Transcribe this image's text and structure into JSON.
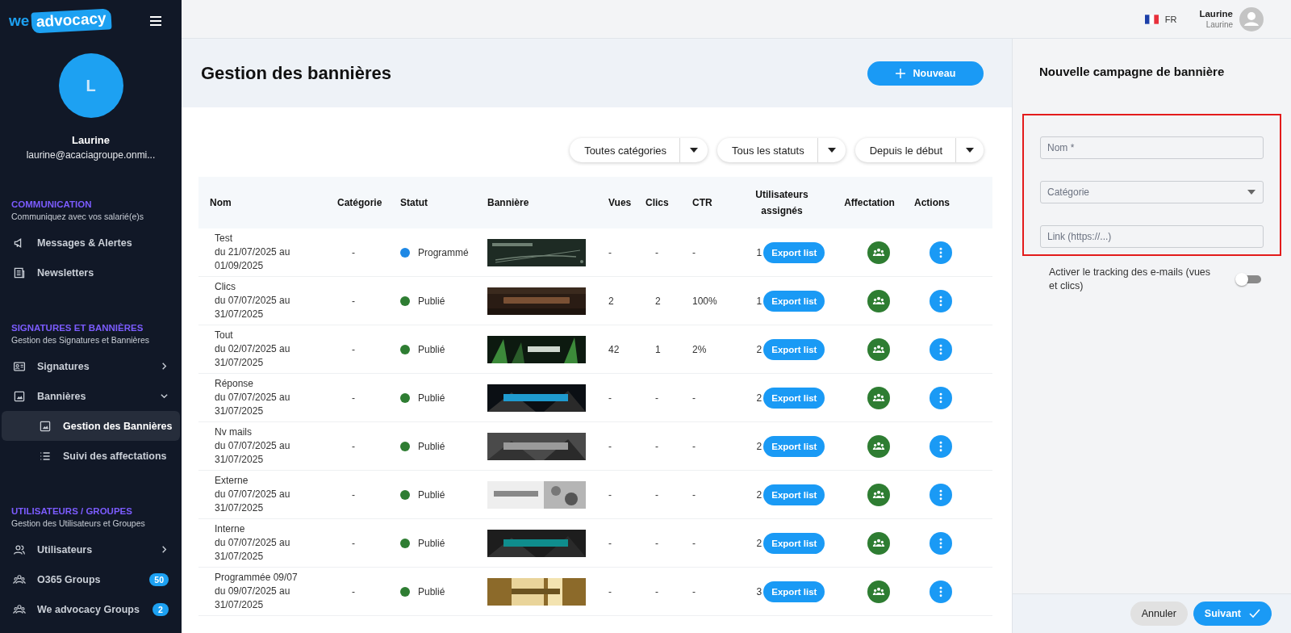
{
  "logo": {
    "part1": "we",
    "part2": "advocacy"
  },
  "profile": {
    "initial": "L",
    "name": "Laurine",
    "email": "laurine@acaciagroupe.onmi..."
  },
  "sidebar": {
    "sections": [
      {
        "title": "COMMUNICATION",
        "subtitle": "Communiquez avec vos salarié(e)s",
        "items": [
          {
            "kind": "link",
            "label": "Messages & Alertes",
            "selected": false
          },
          {
            "kind": "link",
            "label": "Newsletters",
            "selected": false
          }
        ]
      },
      {
        "title": "SIGNATURES ET BANNIÈRES",
        "subtitle": "Gestion des Signatures et Bannières",
        "items": [
          {
            "kind": "group",
            "label": "Signatures",
            "selected": false,
            "expanded": false
          },
          {
            "kind": "group",
            "label": "Bannières",
            "selected": false,
            "expanded": true,
            "children": [
              {
                "label": "Gestion des Bannières",
                "selected": true
              },
              {
                "label": "Suivi des affectations",
                "selected": false
              }
            ]
          }
        ]
      },
      {
        "title": "UTILISATEURS / GROUPES",
        "subtitle": "Gestion des Utilisateurs et Groupes",
        "items": [
          {
            "kind": "group",
            "label": "Utilisateurs",
            "selected": false,
            "expanded": false
          },
          {
            "kind": "link",
            "label": "O365 Groups",
            "selected": false,
            "badge": "50"
          },
          {
            "kind": "link",
            "label": "We advocacy Groups",
            "selected": false,
            "badge": "2"
          }
        ]
      }
    ]
  },
  "topbar": {
    "language": "FR",
    "user_name": "Laurine",
    "user_subtitle": "Laurine"
  },
  "page": {
    "title": "Gestion des bannières",
    "new_button": "Nouveau"
  },
  "filters": [
    "Toutes catégories",
    "Tous les statuts",
    "Depuis le début"
  ],
  "table": {
    "columns": [
      "Nom",
      "Catégorie",
      "Statut",
      "Bannière",
      "Vues",
      "Clics",
      "CTR",
      "Utilisateurs assignés",
      "Affectation",
      "Actions"
    ],
    "rows": [
      {
        "name": "Test",
        "period": "du 21/07/2025 au 01/09/2025",
        "category": "-",
        "status": "Programmé",
        "color": "#1e88e5",
        "views": "-",
        "clicks": "-",
        "ctr": "-",
        "users": "1",
        "export": "Export list"
      },
      {
        "name": "Clics",
        "period": "du 07/07/2025 au 31/07/2025",
        "category": "-",
        "status": "Publié",
        "color": "#2e7d32",
        "views": "2",
        "clicks": "2",
        "ctr": "100%",
        "users": "1",
        "export": "Export list"
      },
      {
        "name": "Tout",
        "period": "du 02/07/2025 au 31/07/2025",
        "category": "-",
        "status": "Publié",
        "color": "#2e7d32",
        "views": "42",
        "clicks": "1",
        "ctr": "2%",
        "users": "2",
        "export": "Export list"
      },
      {
        "name": "Réponse",
        "period": "du 07/07/2025 au 31/07/2025",
        "category": "-",
        "status": "Publié",
        "color": "#2e7d32",
        "views": "-",
        "clicks": "-",
        "ctr": "-",
        "users": "2",
        "export": "Export list"
      },
      {
        "name": "Nv mails",
        "period": "du 07/07/2025 au 31/07/2025",
        "category": "-",
        "status": "Publié",
        "color": "#2e7d32",
        "views": "-",
        "clicks": "-",
        "ctr": "-",
        "users": "2",
        "export": "Export list"
      },
      {
        "name": "Externe",
        "period": "du 07/07/2025 au 31/07/2025",
        "category": "-",
        "status": "Publié",
        "color": "#2e7d32",
        "views": "-",
        "clicks": "-",
        "ctr": "-",
        "users": "2",
        "export": "Export list"
      },
      {
        "name": "Interne",
        "period": "du 07/07/2025 au 31/07/2025",
        "category": "-",
        "status": "Publié",
        "color": "#2e7d32",
        "views": "-",
        "clicks": "-",
        "ctr": "-",
        "users": "2",
        "export": "Export list"
      },
      {
        "name": "Programmée 09/07",
        "period": "du 09/07/2025 au 31/07/2025",
        "category": "-",
        "status": "Publié",
        "color": "#2e7d32",
        "views": "-",
        "clicks": "-",
        "ctr": "-",
        "users": "3",
        "export": "Export list"
      }
    ]
  },
  "panel": {
    "title": "Nouvelle campagne de bannière",
    "fields": [
      {
        "kind": "text",
        "placeholder": "Nom *"
      },
      {
        "kind": "select",
        "placeholder": "Catégorie"
      },
      {
        "kind": "text",
        "placeholder": "Link (https://...)"
      }
    ],
    "tracking": {
      "label": "Activer le tracking des e-mails (vues et clics)",
      "on": false
    },
    "buttons": {
      "cancel": "Annuler",
      "next": "Suivant"
    }
  }
}
